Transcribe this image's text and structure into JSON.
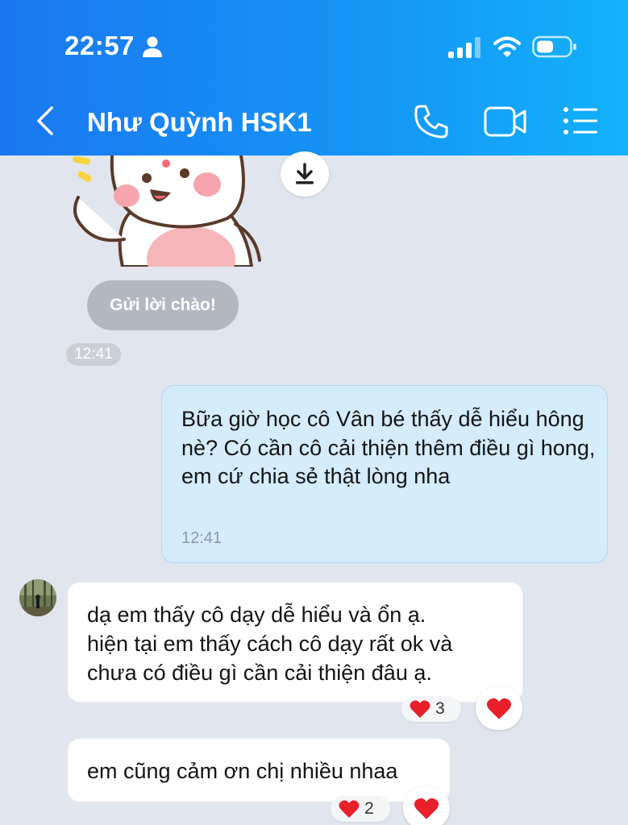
{
  "status_bar": {
    "time": "22:57"
  },
  "header": {
    "title": "Như Quỳnh HSK1"
  },
  "messages": {
    "greet_chip": "Gửi lời chào!",
    "greet_time": "12:41",
    "outgoing": {
      "text": "Bữa giờ học cô Vân bé thấy dễ hiểu hông nè? Có cần cô cải thiện thêm điều gì hong, em cứ chia sẻ thật lòng nha",
      "time": "12:41"
    },
    "incoming": [
      {
        "lines": [
          "dạ em thấy cô dạy dễ hiểu và  ổn ạ.",
          "hiện tại em thấy cách cô dạy rất ok và",
          "chưa có điều gì cần cải thiện đâu ạ."
        ],
        "reaction_count": "3"
      },
      {
        "lines": [
          "em cũng cảm ơn chị nhiều nhaa"
        ],
        "reaction_count": "2"
      }
    ]
  },
  "colors": {
    "header_gradient_start": "#1a78f0",
    "header_gradient_end": "#12b2f9",
    "background": "#e1e5ee",
    "outgoing_bubble": "#d4ecfc",
    "heart": "#e8202a"
  }
}
